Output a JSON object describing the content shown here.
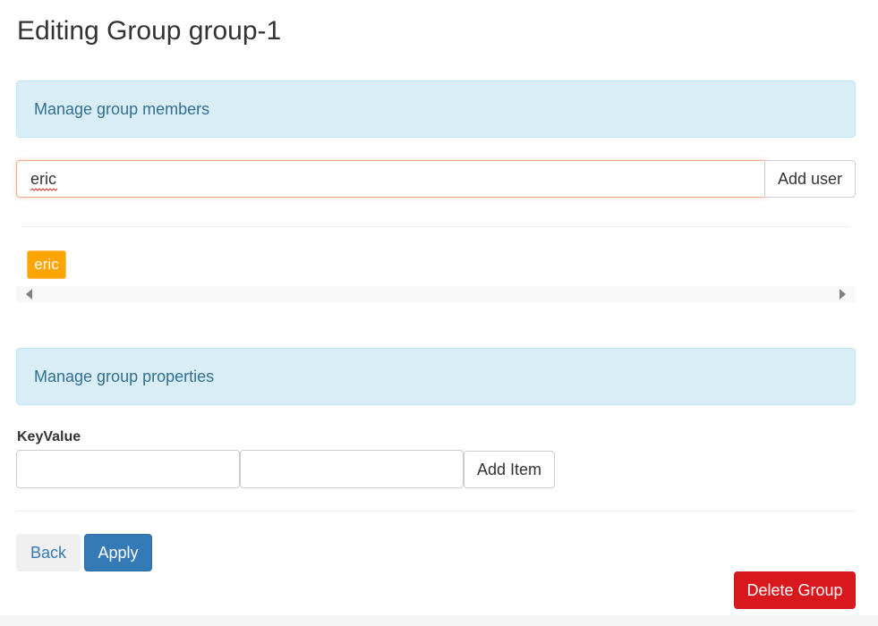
{
  "page": {
    "title": "Editing Group group-1"
  },
  "members_section": {
    "header": "Manage group members",
    "input_value": "eric",
    "add_user_label": "Add user",
    "members": [
      "eric"
    ],
    "member_tag_color": "#ffa500"
  },
  "properties_section": {
    "header": "Manage group properties",
    "label": "KeyValue",
    "key_value": "",
    "value_value": "",
    "add_item_label": "Add Item"
  },
  "actions": {
    "back_label": "Back",
    "apply_label": "Apply",
    "delete_label": "Delete Group"
  },
  "colors": {
    "info_bg": "#d9edf7",
    "info_text": "#31708f",
    "primary": "#337ab7",
    "danger": "#d9181e"
  }
}
